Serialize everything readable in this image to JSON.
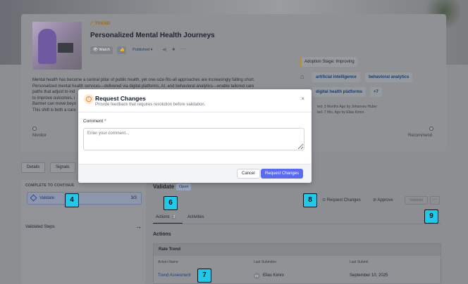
{
  "trend": {
    "label": "TREND",
    "title": "Personalized Mental Health Journeys",
    "watch_label": "Watch",
    "status_label": "Published",
    "adoption_stage": "Adoption Stage: Improving",
    "tags": [
      "artificial intelligence",
      "behavioral analytics",
      "digital health platforms"
    ],
    "tags_more": "+7",
    "description": [
      "Mental health has become a central pillar of public health, yet one-size-fits-all approaches are increasingly falling short.",
      "Personalized mental health services—delivered via digital platforms, AI, and behavioral analytics—enable tailored care",
      "paths that adjust to ind",
      "to improve outcomes, i",
      "Barmer can move beyo",
      "This shift is both a care"
    ],
    "meta": [
      "ted: 3 Months Ago by Johannes Huber",
      "ted: 7 Min. Ago by Elias Kimm"
    ],
    "timeline": {
      "left": "Monitor",
      "right": "Recommend"
    }
  },
  "page_tabs": [
    "Details",
    "Signals"
  ],
  "left_panel": {
    "title": "COMPLETE TO CONTINUE",
    "step_label": "Validate",
    "step_count": "3/3",
    "validated_steps": "Validated Steps"
  },
  "main": {
    "title": "Validate",
    "status": "Open",
    "actions": {
      "request_changes": "Request Changes",
      "approve": "Approve",
      "validate": "Validate",
      "more": "···"
    },
    "subtabs": [
      {
        "label": "Actions",
        "count": "3"
      },
      {
        "label": "Activities"
      }
    ],
    "section_title": "Actions",
    "table": {
      "group": "Rate Trend",
      "columns": [
        "Action Name",
        "Last Submitter",
        "Last Submit"
      ],
      "rows": [
        {
          "action": "Trend Assesment",
          "initials": "EK",
          "submitter": "Elias Kimm",
          "date": "September 10, 2025"
        }
      ]
    }
  },
  "markers": [
    "4",
    "6",
    "8",
    "9",
    "7"
  ],
  "modal": {
    "title": "Request Changes",
    "subtitle": "Provide feedback that requires resolution before validation.",
    "close": "×",
    "comment_label": "Comment",
    "required_mark": "*",
    "comment_placeholder": "Enter your comment...",
    "cancel_label": "Cancel",
    "submit_label": "Request Changes"
  }
}
